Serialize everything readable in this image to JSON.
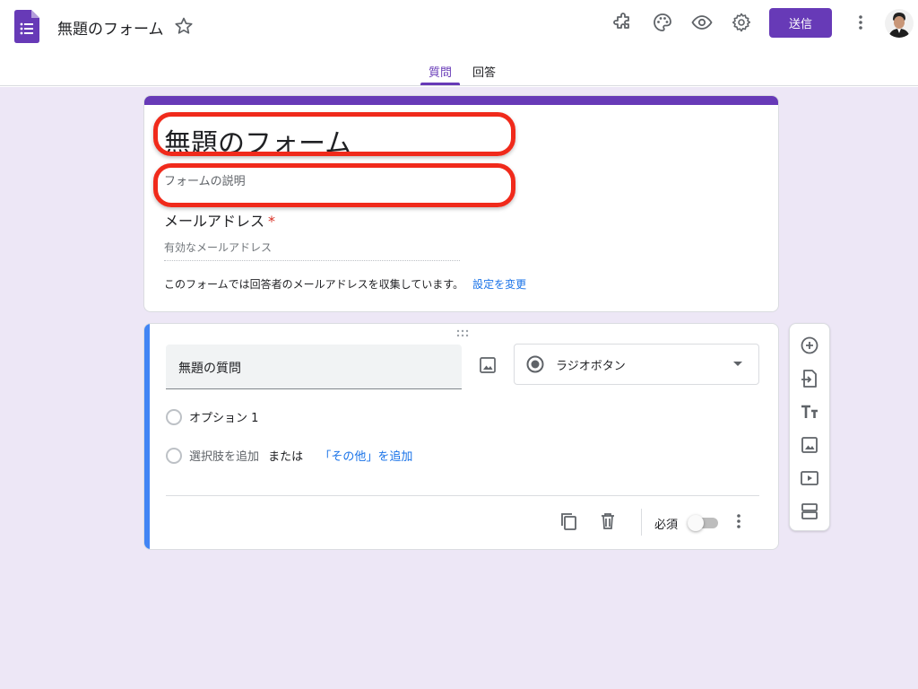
{
  "header": {
    "doc_title": "無題のフォーム",
    "send_label": "送信",
    "tabs": [
      {
        "label": "質問",
        "active": true
      },
      {
        "label": "回答",
        "active": false
      }
    ],
    "icons": [
      "forms-app-icon",
      "star-icon",
      "addon-puzzle-icon",
      "palette-icon",
      "preview-eye-icon",
      "settings-gear-icon",
      "more-vert-icon"
    ]
  },
  "form": {
    "title": "無題のフォーム",
    "description_placeholder": "フォームの説明",
    "email": {
      "label": "メールアドレス",
      "required_mark": "*",
      "placeholder": "有効なメールアドレス"
    },
    "collect_note": "このフォームでは回答者のメールアドレスを収集しています。",
    "collect_link": "設定を変更"
  },
  "question": {
    "title": "無題の質問",
    "type": "ラジオボタン",
    "option1": "オプション 1",
    "add_option": "選択肢を追加",
    "or": "または",
    "add_other": "「その他」を追加",
    "required_label": "必須",
    "required": false
  },
  "toolbar": {
    "items": [
      "add-question-icon",
      "import-questions-icon",
      "add-title-icon",
      "add-image-icon",
      "add-video-icon",
      "add-section-icon"
    ]
  },
  "colors": {
    "accent": "#673ab7",
    "background": "#ede7f6",
    "link": "#1a73e8",
    "active_question_bar": "#4285f4",
    "annotation": "#f02a1b"
  }
}
